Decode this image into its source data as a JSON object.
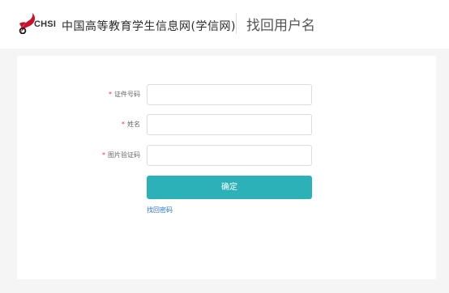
{
  "header": {
    "logo_text": "CHSI",
    "site_name": "中国高等教育学生信息网(学信网)",
    "page_title": "找回用户名"
  },
  "form": {
    "required_mark": "*",
    "fields": [
      {
        "label": "证件号码",
        "value": "",
        "placeholder": ""
      },
      {
        "label": "姓名",
        "value": "",
        "placeholder": ""
      },
      {
        "label": "图片验证码",
        "value": "",
        "placeholder": ""
      }
    ],
    "submit_label": "确定",
    "recover_password_link": "找回密码"
  },
  "colors": {
    "accent": "#2db1b9",
    "logo_red": "#c8102e",
    "required": "#e4393c",
    "link": "#2a72c9"
  },
  "icons": {
    "logo": "chsi-bird-logo-icon"
  }
}
